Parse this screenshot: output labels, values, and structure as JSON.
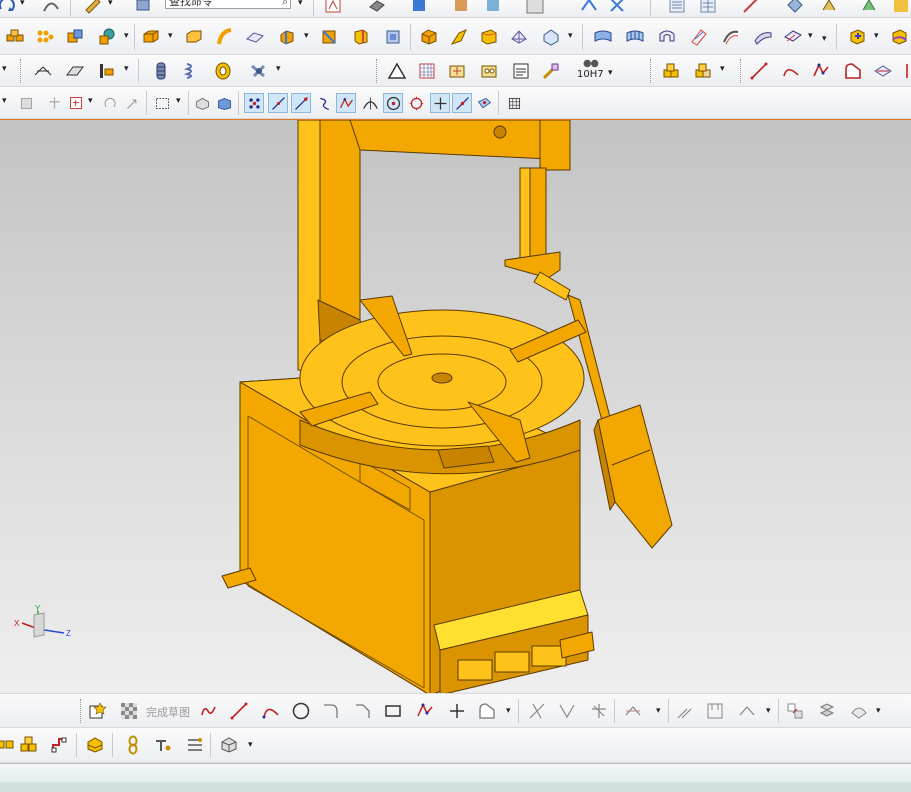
{
  "toolbar": {
    "search_placeholder": "查找命令",
    "tolerance_label": "10H7"
  },
  "sketch_toolbar": {
    "finish_sketch_label": "完成草图"
  },
  "colors": {
    "model": "#f2a800",
    "model_light": "#ffc21a",
    "model_dark": "#c88400",
    "model_outline": "#5a3a00",
    "viewport_top": "#c3c3c3",
    "viewport_bottom": "#eeeeee",
    "accent_line": "#e07a2a"
  },
  "icons": {
    "row1": [
      "rotate-icon",
      "feature-icon",
      "search-icon",
      "sketch-icon",
      "layer-icon",
      "view-icon",
      "shaded-icon",
      "render-icon",
      "display-icon",
      "list-icon",
      "table-icon",
      "measure-icon",
      "analysis-icon",
      "snap-icon",
      "assembly-icon"
    ],
    "row2": [
      "block-array-icon",
      "pattern-icon",
      "unite-icon",
      "subtract-icon",
      "extrude-icon",
      "revolve-icon",
      "sweep-icon",
      "surface-icon",
      "chamfer-icon",
      "blend-icon",
      "shell-icon",
      "draft-icon",
      "trim-icon",
      "offset-icon",
      "thicken-icon",
      "mesh-icon",
      "curve-network-icon",
      "through-curves-icon",
      "n-sided-icon",
      "face-blend-icon",
      "silhouette-icon",
      "wrap-icon"
    ],
    "row3": [
      "line-tool-icon",
      "loft-icon",
      "move-face-icon",
      "coil-icon",
      "spring-icon",
      "thread-icon",
      "pin-icon",
      "triangle-icon",
      "grid-icon",
      "dimension-icon",
      "note-icon",
      "datum-icon",
      "paint-icon",
      "tolerance-icon",
      "box-stack-icon",
      "box-stack-alt-icon",
      "line-icon",
      "arc-icon",
      "polyline-icon",
      "profile-icon",
      "ribbon-icon"
    ],
    "row4": [
      "select-icon",
      "filter-icon",
      "snap-point-icon",
      "snap-add-icon",
      "snap-rotate-icon",
      "snap-move-icon",
      "rectangle-select-icon",
      "cube-icon",
      "cube-solid-icon",
      "endpoint-icon",
      "midpoint-icon",
      "center-icon",
      "arc-snap-icon",
      "tangent-icon",
      "intersect-icon",
      "circle-center-icon",
      "quadrant-icon",
      "existing-point-icon",
      "on-curve-icon",
      "on-face-icon",
      "grid-snap-icon"
    ],
    "sketch": [
      "finish-sketch-icon",
      "profile-icon",
      "line-icon",
      "arc-icon",
      "circle-icon",
      "fillet-icon",
      "chamfer-icon",
      "rectangle-icon",
      "polygon-icon",
      "point-icon",
      "studio-spline-icon",
      "trim-icon",
      "extend-icon",
      "make-corner-icon",
      "mirror-icon",
      "offset-curve-icon",
      "pattern-icon",
      "constraint-icon",
      "continuous-constraint-icon",
      "auto-dimension-icon",
      "display-constraint-icon",
      "sketch-palette-icon"
    ],
    "bottom": [
      "align-icon",
      "group-icon",
      "corner-icon",
      "layers-icon",
      "link-icon",
      "sequence-icon",
      "component-icon",
      "box-icon"
    ]
  }
}
